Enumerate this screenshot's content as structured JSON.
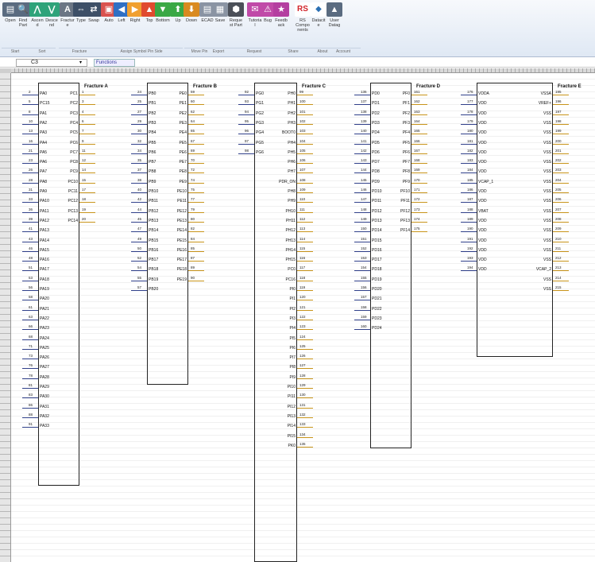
{
  "ribbon": {
    "buttons": [
      {
        "label": "Open",
        "icon": "open-icon",
        "color": "#5a6b80",
        "glyph": "▤"
      },
      {
        "label": "Find Part",
        "icon": "find-icon",
        "color": "#5a6b80",
        "glyph": "🔍"
      },
      {
        "label": "Ascend",
        "icon": "ascend-icon",
        "color": "#2ea37a",
        "glyph": "⋀"
      },
      {
        "label": "Descend",
        "icon": "descend-icon",
        "color": "#2ea37a",
        "glyph": "⋁"
      },
      {
        "label": "Fracture",
        "icon": "fracture-icon",
        "color": "#6b7685",
        "glyph": "A"
      },
      {
        "label": "Type",
        "icon": "type-icon",
        "color": "#3d4f67",
        "glyph": "⇔"
      },
      {
        "label": "Swap",
        "icon": "swap-icon",
        "color": "#3d4f67",
        "glyph": "⇄"
      },
      {
        "label": "Auto",
        "icon": "auto-icon",
        "color": "#d9534f",
        "glyph": "▣"
      },
      {
        "label": "Left",
        "icon": "left-arrow-icon",
        "color": "#2f6fc4",
        "glyph": "◀"
      },
      {
        "label": "Right",
        "icon": "right-arrow-icon",
        "color": "#f0a030",
        "glyph": "▶"
      },
      {
        "label": "Top",
        "icon": "top-arrow-icon",
        "color": "#e04a2e",
        "glyph": "▲"
      },
      {
        "label": "Bottom",
        "icon": "bottom-arrow-icon",
        "color": "#3aa845",
        "glyph": "▼"
      },
      {
        "label": "Up",
        "icon": "up-icon",
        "color": "#3aa845",
        "glyph": "⬆"
      },
      {
        "label": "Down",
        "icon": "down-icon",
        "color": "#d98a20",
        "glyph": "⬇"
      },
      {
        "label": "ECAD",
        "icon": "ecad-icon",
        "color": "#8a94a3",
        "glyph": "▤"
      },
      {
        "label": "Save",
        "icon": "save-icon",
        "color": "#8a94a3",
        "glyph": "▦"
      },
      {
        "label": "Request Part",
        "icon": "request-icon",
        "color": "#4a4f58",
        "glyph": "⬢"
      },
      {
        "label": "Tutorial",
        "icon": "tutorial-icon",
        "color": "#c04aa8",
        "glyph": "✉"
      },
      {
        "label": "Bug",
        "icon": "bug-icon",
        "color": "#c04aa8",
        "glyph": "⚠"
      },
      {
        "label": "Feedback",
        "icon": "feedback-icon",
        "color": "#b43fa0",
        "glyph": "★"
      },
      {
        "label": "RS Components",
        "icon": "rs-logo-icon",
        "color": "#ffffff",
        "glyph": "RS"
      },
      {
        "label": "Datacite",
        "icon": "datacite-icon",
        "color": "#ffffff",
        "glyph": "◆"
      },
      {
        "label": "User Datag",
        "icon": "user-icon",
        "color": "#5a6b80",
        "glyph": "▲"
      }
    ],
    "groups": [
      {
        "label": "Start"
      },
      {
        "label": "Sort"
      },
      {
        "label": "Fracture"
      },
      {
        "label": "Assign Symbol Pin Side"
      },
      {
        "label": "Move Pin"
      },
      {
        "label": "Export"
      },
      {
        "label": "Request"
      },
      {
        "label": "Share"
      },
      {
        "label": "About"
      },
      {
        "label": "Account"
      }
    ]
  },
  "formula_bar": {
    "cell_ref": "C3",
    "fx_label": "Functions"
  },
  "components": [
    {
      "title": "Fracture A",
      "left": [
        {
          "n": "2",
          "p": "PA0"
        },
        {
          "n": "5",
          "p": "PC15"
        },
        {
          "n": "8",
          "p": "PA1"
        },
        {
          "n": "10",
          "p": "PA2"
        },
        {
          "n": "13",
          "p": "PA3"
        },
        {
          "n": "16",
          "p": "PA4"
        },
        {
          "n": "21",
          "p": "PA5"
        },
        {
          "n": "23",
          "p": "PA6"
        },
        {
          "n": "26",
          "p": "PA7"
        },
        {
          "n": "28",
          "p": "PA8"
        },
        {
          "n": "31",
          "p": "PA9"
        },
        {
          "n": "33",
          "p": "PA10"
        },
        {
          "n": "36",
          "p": "PA11"
        },
        {
          "n": "39",
          "p": "PA12"
        },
        {
          "n": "41",
          "p": "PA13"
        },
        {
          "n": "43",
          "p": "PA14"
        },
        {
          "n": "46",
          "p": "PA15"
        },
        {
          "n": "48",
          "p": "PA16"
        },
        {
          "n": "51",
          "p": "PA17"
        },
        {
          "n": "53",
          "p": "PA18"
        },
        {
          "n": "56",
          "p": "PA19"
        },
        {
          "n": "58",
          "p": "PA20"
        },
        {
          "n": "61",
          "p": "PA21"
        },
        {
          "n": "63",
          "p": "PA22"
        },
        {
          "n": "66",
          "p": "PA23"
        },
        {
          "n": "68",
          "p": "PA24"
        },
        {
          "n": "71",
          "p": "PA25"
        },
        {
          "n": "73",
          "p": "PA26"
        },
        {
          "n": "76",
          "p": "PA27"
        },
        {
          "n": "78",
          "p": "PA28"
        },
        {
          "n": "81",
          "p": "PA29"
        },
        {
          "n": "83",
          "p": "PA30"
        },
        {
          "n": "86",
          "p": "PA31"
        },
        {
          "n": "88",
          "p": "PA32"
        },
        {
          "n": "91",
          "p": "PA33"
        }
      ],
      "right": [
        {
          "n": "1",
          "p": "PC1"
        },
        {
          "n": "3",
          "p": "PC2"
        },
        {
          "n": "4",
          "p": "PC3"
        },
        {
          "n": "6",
          "p": "PC4"
        },
        {
          "n": "7",
          "p": "PC5"
        },
        {
          "n": "9",
          "p": "PC6"
        },
        {
          "n": "11",
          "p": "PC7"
        },
        {
          "n": "12",
          "p": "PC8"
        },
        {
          "n": "14",
          "p": "PC9"
        },
        {
          "n": "15",
          "p": "PC10"
        },
        {
          "n": "17",
          "p": "PC11"
        },
        {
          "n": "18",
          "p": "PC12"
        },
        {
          "n": "19",
          "p": "PC13"
        },
        {
          "n": "20",
          "p": "PC14"
        }
      ]
    },
    {
      "title": "Fracture B",
      "left": [
        {
          "n": "24",
          "p": "PB0"
        },
        {
          "n": "25",
          "p": "PB1"
        },
        {
          "n": "27",
          "p": "PB2"
        },
        {
          "n": "29",
          "p": "PB3"
        },
        {
          "n": "30",
          "p": "PB4"
        },
        {
          "n": "32",
          "p": "PB5"
        },
        {
          "n": "34",
          "p": "PB6"
        },
        {
          "n": "35",
          "p": "PB7"
        },
        {
          "n": "37",
          "p": "PB8"
        },
        {
          "n": "38",
          "p": "PB9"
        },
        {
          "n": "40",
          "p": "PB10"
        },
        {
          "n": "42",
          "p": "PB11"
        },
        {
          "n": "44",
          "p": "PB12"
        },
        {
          "n": "45",
          "p": "PB13"
        },
        {
          "n": "47",
          "p": "PB14"
        },
        {
          "n": "49",
          "p": "PB15"
        },
        {
          "n": "50",
          "p": "PB16"
        },
        {
          "n": "52",
          "p": "PB17"
        },
        {
          "n": "54",
          "p": "PB18"
        },
        {
          "n": "55",
          "p": "PB19"
        },
        {
          "n": "57",
          "p": "PB20"
        }
      ],
      "right": [
        {
          "n": "59",
          "p": "PE0"
        },
        {
          "n": "60",
          "p": "PE1"
        },
        {
          "n": "62",
          "p": "PE2"
        },
        {
          "n": "64",
          "p": "PE3"
        },
        {
          "n": "65",
          "p": "PE4"
        },
        {
          "n": "67",
          "p": "PE5"
        },
        {
          "n": "69",
          "p": "PE6"
        },
        {
          "n": "70",
          "p": "PE7"
        },
        {
          "n": "72",
          "p": "PE8"
        },
        {
          "n": "74",
          "p": "PE9"
        },
        {
          "n": "75",
          "p": "PE10"
        },
        {
          "n": "77",
          "p": "PE11"
        },
        {
          "n": "79",
          "p": "PE12"
        },
        {
          "n": "80",
          "p": "PE13"
        },
        {
          "n": "82",
          "p": "PE14"
        },
        {
          "n": "84",
          "p": "PE15"
        },
        {
          "n": "85",
          "p": "PE16"
        },
        {
          "n": "87",
          "p": "PE17"
        },
        {
          "n": "89",
          "p": "PE18"
        },
        {
          "n": "90",
          "p": "PE19"
        }
      ]
    },
    {
      "title": "Fracture C",
      "left": [
        {
          "n": "92",
          "p": "PG0"
        },
        {
          "n": "93",
          "p": "PG1"
        },
        {
          "n": "94",
          "p": "PG2"
        },
        {
          "n": "95",
          "p": "PG3"
        },
        {
          "n": "96",
          "p": "PG4"
        },
        {
          "n": "97",
          "p": "PG5"
        },
        {
          "n": "98",
          "p": "PG6"
        }
      ],
      "right": [
        {
          "n": "99",
          "p": "PH0"
        },
        {
          "n": "100",
          "p": "PH1"
        },
        {
          "n": "101",
          "p": "PH2"
        },
        {
          "n": "102",
          "p": "PH3"
        },
        {
          "n": "103",
          "p": "BOOT0"
        },
        {
          "n": "104",
          "p": "PH4"
        },
        {
          "n": "105",
          "p": "PH5"
        },
        {
          "n": "106",
          "p": "PH6"
        },
        {
          "n": "107",
          "p": "PH7"
        },
        {
          "n": "108",
          "p": "PDR_ON"
        },
        {
          "n": "109",
          "p": "PH8"
        },
        {
          "n": "110",
          "p": "PH9"
        },
        {
          "n": "111",
          "p": "PH10"
        },
        {
          "n": "112",
          "p": "PH11"
        },
        {
          "n": "113",
          "p": "PH12"
        },
        {
          "n": "114",
          "p": "PH13"
        },
        {
          "n": "115",
          "p": "PH14"
        },
        {
          "n": "116",
          "p": "PH15"
        },
        {
          "n": "117",
          "p": "PC0"
        },
        {
          "n": "118",
          "p": "PC16"
        },
        {
          "n": "119",
          "p": "PI0"
        },
        {
          "n": "120",
          "p": "PI1"
        },
        {
          "n": "121",
          "p": "PI2"
        },
        {
          "n": "122",
          "p": "PI3"
        },
        {
          "n": "123",
          "p": "PI4"
        },
        {
          "n": "124",
          "p": "PI5"
        },
        {
          "n": "125",
          "p": "PI6"
        },
        {
          "n": "126",
          "p": "PI7"
        },
        {
          "n": "127",
          "p": "PI8"
        },
        {
          "n": "128",
          "p": "PI9"
        },
        {
          "n": "129",
          "p": "PI10"
        },
        {
          "n": "130",
          "p": "PI11"
        },
        {
          "n": "131",
          "p": "PI12"
        },
        {
          "n": "132",
          "p": "PI13"
        },
        {
          "n": "133",
          "p": "PI14"
        },
        {
          "n": "134",
          "p": "PI15"
        },
        {
          "n": "135",
          "p": "PK0"
        }
      ]
    },
    {
      "title": "Fracture D",
      "left": [
        {
          "n": "136",
          "p": "PD0"
        },
        {
          "n": "137",
          "p": "PD1"
        },
        {
          "n": "138",
          "p": "PD2"
        },
        {
          "n": "139",
          "p": "PD3"
        },
        {
          "n": "140",
          "p": "PD4"
        },
        {
          "n": "141",
          "p": "PD5"
        },
        {
          "n": "142",
          "p": "PD6"
        },
        {
          "n": "143",
          "p": "PD7"
        },
        {
          "n": "144",
          "p": "PD8"
        },
        {
          "n": "145",
          "p": "PD9"
        },
        {
          "n": "146",
          "p": "PD10"
        },
        {
          "n": "147",
          "p": "PD11"
        },
        {
          "n": "148",
          "p": "PD12"
        },
        {
          "n": "149",
          "p": "PD13"
        },
        {
          "n": "150",
          "p": "PD14"
        },
        {
          "n": "151",
          "p": "PD15"
        },
        {
          "n": "152",
          "p": "PD16"
        },
        {
          "n": "153",
          "p": "PD17"
        },
        {
          "n": "154",
          "p": "PD18"
        },
        {
          "n": "155",
          "p": "PD19"
        },
        {
          "n": "156",
          "p": "PD20"
        },
        {
          "n": "157",
          "p": "PD21"
        },
        {
          "n": "158",
          "p": "PD22"
        },
        {
          "n": "159",
          "p": "PD23"
        },
        {
          "n": "160",
          "p": "PD24"
        }
      ],
      "right": [
        {
          "n": "161",
          "p": "PF0"
        },
        {
          "n": "162",
          "p": "PF1"
        },
        {
          "n": "163",
          "p": "PF2"
        },
        {
          "n": "164",
          "p": "PF3"
        },
        {
          "n": "165",
          "p": "PF4"
        },
        {
          "n": "166",
          "p": "PF5"
        },
        {
          "n": "167",
          "p": "PF6"
        },
        {
          "n": "168",
          "p": "PF7"
        },
        {
          "n": "169",
          "p": "PF8"
        },
        {
          "n": "170",
          "p": "PF9"
        },
        {
          "n": "171",
          "p": "PF10"
        },
        {
          "n": "172",
          "p": "PF11"
        },
        {
          "n": "173",
          "p": "PF12"
        },
        {
          "n": "174",
          "p": "PF13"
        },
        {
          "n": "175",
          "p": "PF14"
        }
      ]
    },
    {
      "title": "Fracture E",
      "left": [
        {
          "n": "176",
          "p": "VDDA"
        },
        {
          "n": "177",
          "p": "VDD"
        },
        {
          "n": "178",
          "p": "VDD"
        },
        {
          "n": "179",
          "p": "VDD"
        },
        {
          "n": "180",
          "p": "VDD"
        },
        {
          "n": "181",
          "p": "VDD"
        },
        {
          "n": "182",
          "p": "VDD"
        },
        {
          "n": "183",
          "p": "VDD"
        },
        {
          "n": "184",
          "p": "VDD"
        },
        {
          "n": "185",
          "p": "VCAP_1"
        },
        {
          "n": "186",
          "p": "VDD"
        },
        {
          "n": "187",
          "p": "VDD"
        },
        {
          "n": "188",
          "p": "VBAT"
        },
        {
          "n": "189",
          "p": "VDD"
        },
        {
          "n": "190",
          "p": "VDD"
        },
        {
          "n": "191",
          "p": "VDD"
        },
        {
          "n": "192",
          "p": "VDD"
        },
        {
          "n": "193",
          "p": "VDD"
        },
        {
          "n": "194",
          "p": "VDD"
        }
      ],
      "right": [
        {
          "n": "195",
          "p": "VSSA"
        },
        {
          "n": "196",
          "p": "VREF+"
        },
        {
          "n": "197",
          "p": "VSS"
        },
        {
          "n": "198",
          "p": "VSS"
        },
        {
          "n": "199",
          "p": "VSS"
        },
        {
          "n": "200",
          "p": "VSS"
        },
        {
          "n": "201",
          "p": "VSS"
        },
        {
          "n": "202",
          "p": "VSS"
        },
        {
          "n": "203",
          "p": "VSS"
        },
        {
          "n": "204",
          "p": "VSS"
        },
        {
          "n": "205",
          "p": "VSS"
        },
        {
          "n": "206",
          "p": "VSS"
        },
        {
          "n": "207",
          "p": "VSS"
        },
        {
          "n": "208",
          "p": "VSS"
        },
        {
          "n": "209",
          "p": "VSS"
        },
        {
          "n": "210",
          "p": "VSS"
        },
        {
          "n": "211",
          "p": "VSS"
        },
        {
          "n": "212",
          "p": "VSS"
        },
        {
          "n": "213",
          "p": "VCAP_2"
        },
        {
          "n": "214",
          "p": "VSS"
        },
        {
          "n": "215",
          "p": "VSS"
        }
      ]
    }
  ]
}
